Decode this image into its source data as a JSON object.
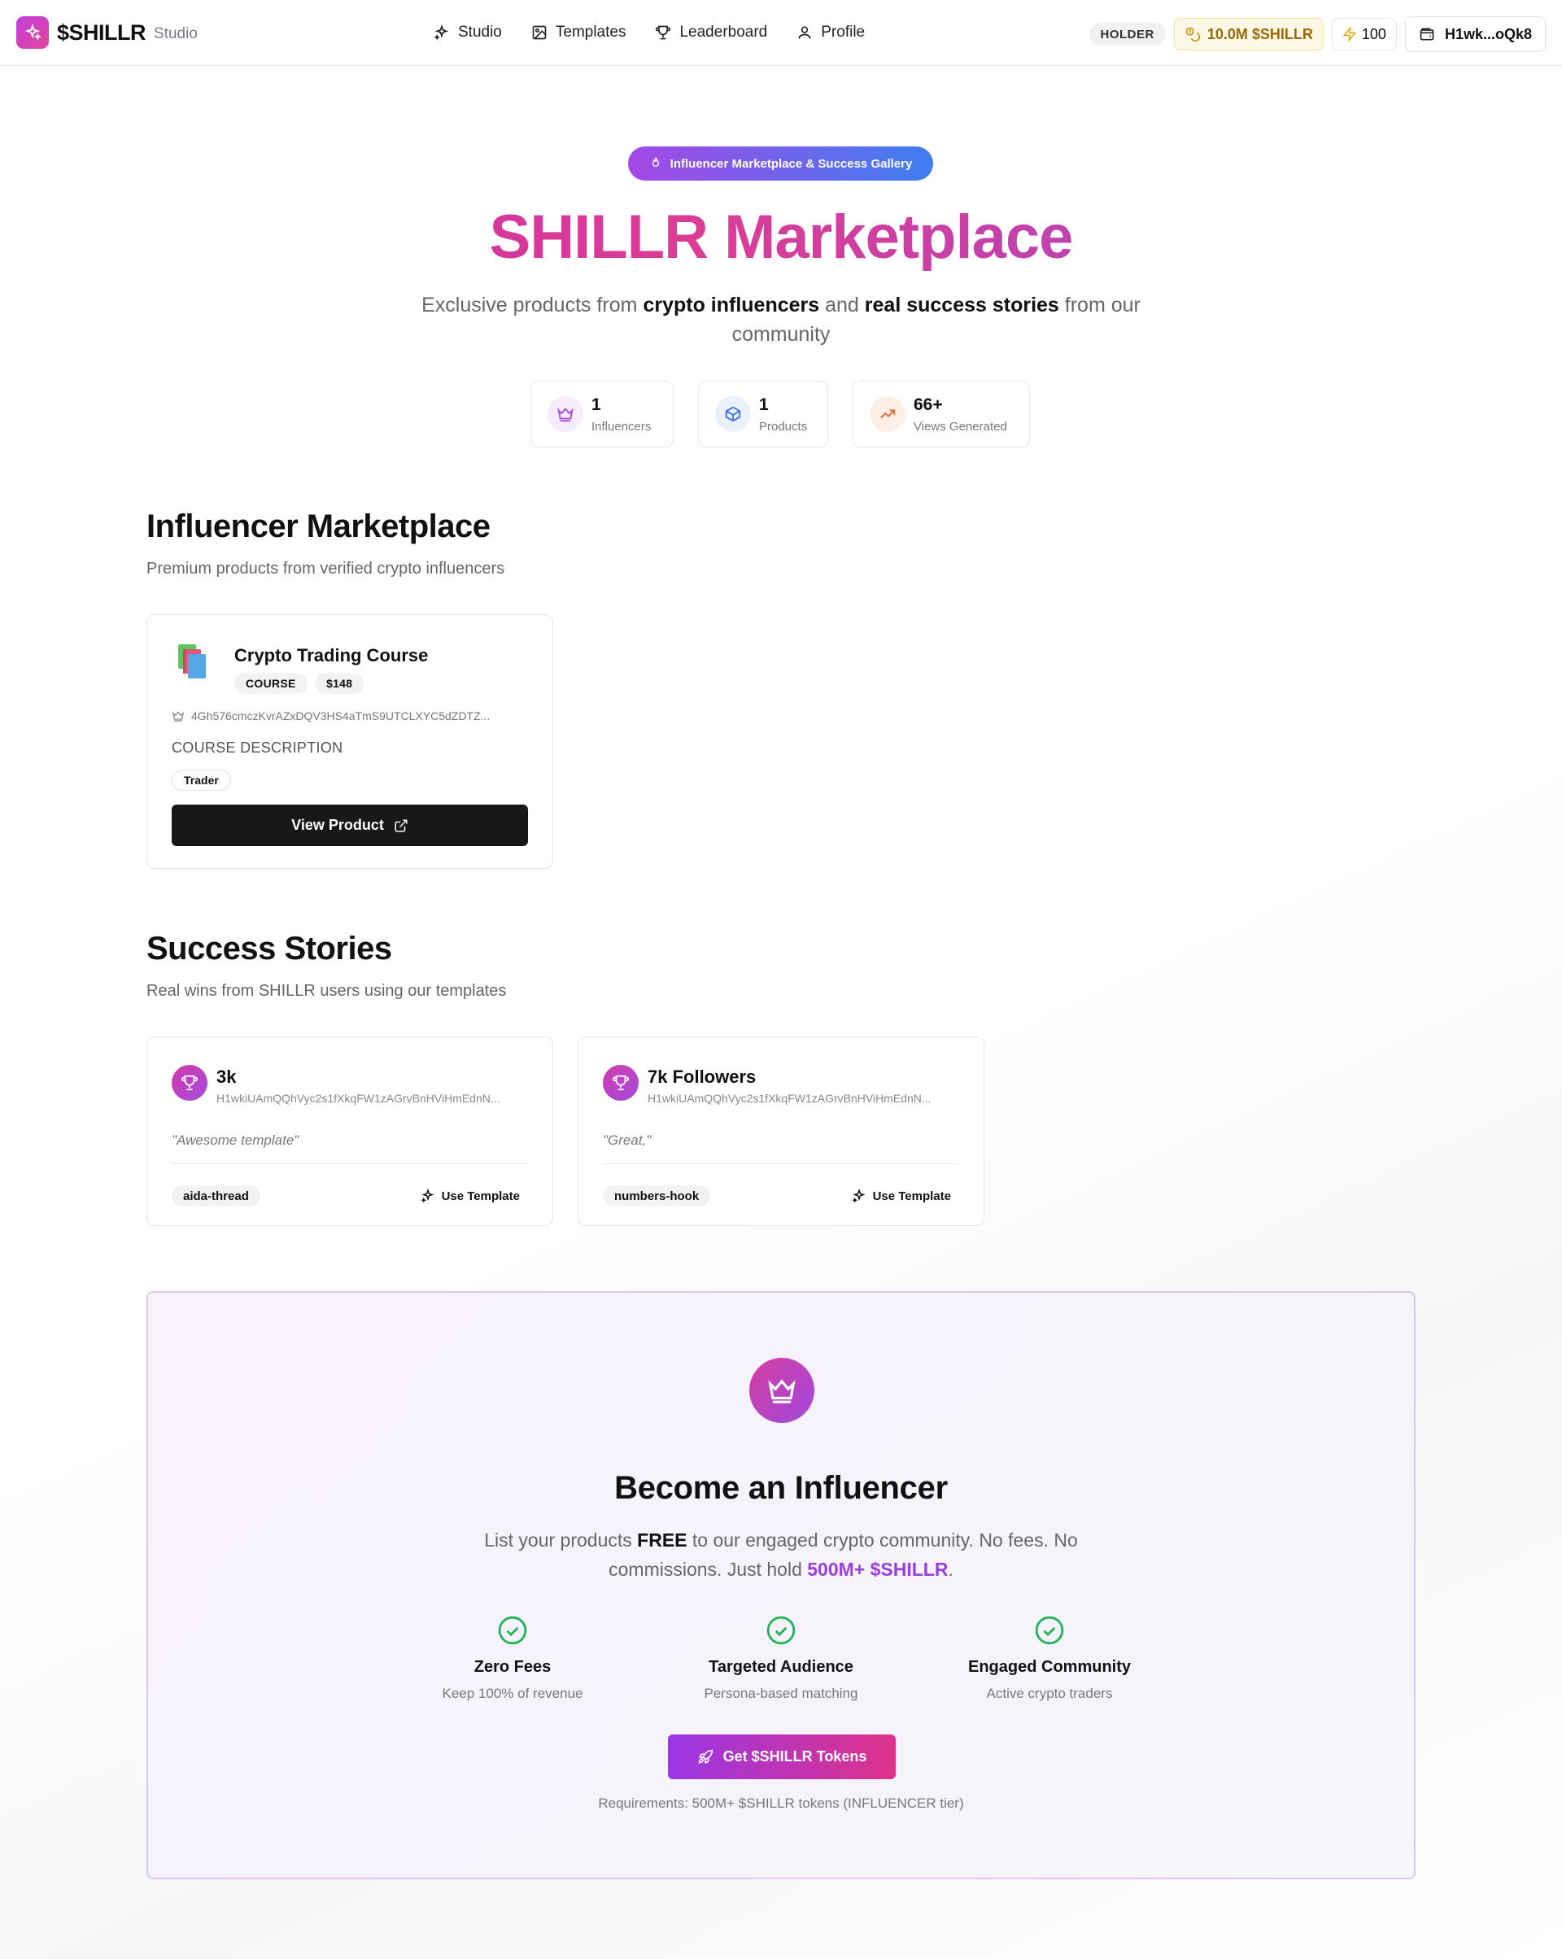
{
  "nav": {
    "brand": "$SHILLR",
    "brand_sub": "Studio",
    "links": [
      "Studio",
      "Templates",
      "Leaderboard",
      "Profile"
    ],
    "tier_badge": "HOLDER",
    "token_balance": "10.0M $SHILLR",
    "credits": "100",
    "wallet": "H1wk...oQk8"
  },
  "hero": {
    "badge": "Influencer Marketplace & Success Gallery",
    "title": "SHILLR Marketplace",
    "subtitle_parts": [
      "Exclusive products from ",
      "crypto influencers",
      " and ",
      "real success stories",
      " from our community"
    ],
    "stats": [
      {
        "value": "1",
        "label": "Influencers",
        "icon": "crown-icon"
      },
      {
        "value": "1",
        "label": "Products",
        "icon": "box-icon"
      },
      {
        "value": "66+",
        "label": "Views Generated",
        "icon": "trending-up-icon"
      }
    ]
  },
  "marketplace": {
    "title": "Influencer Marketplace",
    "subtitle": "Premium products from verified crypto influencers",
    "product": {
      "name": "Crypto Trading Course",
      "type_tag": "COURSE",
      "price": "$148",
      "owner": "4Gh576cmczKvrAZxDQV3HS4aTmS9UTCLXYC5dZDTZ...",
      "description": "COURSE DESCRIPTION",
      "audience_tag": "Trader",
      "button": "View Product"
    }
  },
  "stories": {
    "title": "Success Stories",
    "subtitle": "Real wins from SHILLR users using our templates",
    "items": [
      {
        "title": "3k",
        "address": "H1wkiUAmQQhVyc2s1fXkqFW1zAGrvBnHViHmEdnN...",
        "quote": "\"Awesome template\"",
        "template": "aida-thread",
        "action": "Use Template"
      },
      {
        "title": "7k Followers",
        "address": "H1wkiUAmQQhVyc2s1fXkqFW1zAGrvBnHViHmEdnN...",
        "quote": "\"Great,\"",
        "template": "numbers-hook",
        "action": "Use Template"
      }
    ]
  },
  "cta": {
    "title": "Become an Influencer",
    "subtitle_parts": [
      "List your products ",
      "FREE",
      " to our engaged crypto community. No fees. No commissions. Just hold ",
      "500M+ $SHILLR",
      "."
    ],
    "features": [
      {
        "title": "Zero Fees",
        "subtitle": "Keep 100% of revenue"
      },
      {
        "title": "Targeted Audience",
        "subtitle": "Persona-based matching"
      },
      {
        "title": "Engaged Community",
        "subtitle": "Active crypto traders"
      }
    ],
    "button": "Get $SHILLR Tokens",
    "requirements": "Requirements: 500M+ $SHILLR tokens (INFLUENCER tier)"
  },
  "colors": {
    "accent_purple": "#9a3ee0",
    "accent_pink": "#de3288",
    "token_gold": "#9a6a08",
    "success_green": "#22b35a"
  }
}
